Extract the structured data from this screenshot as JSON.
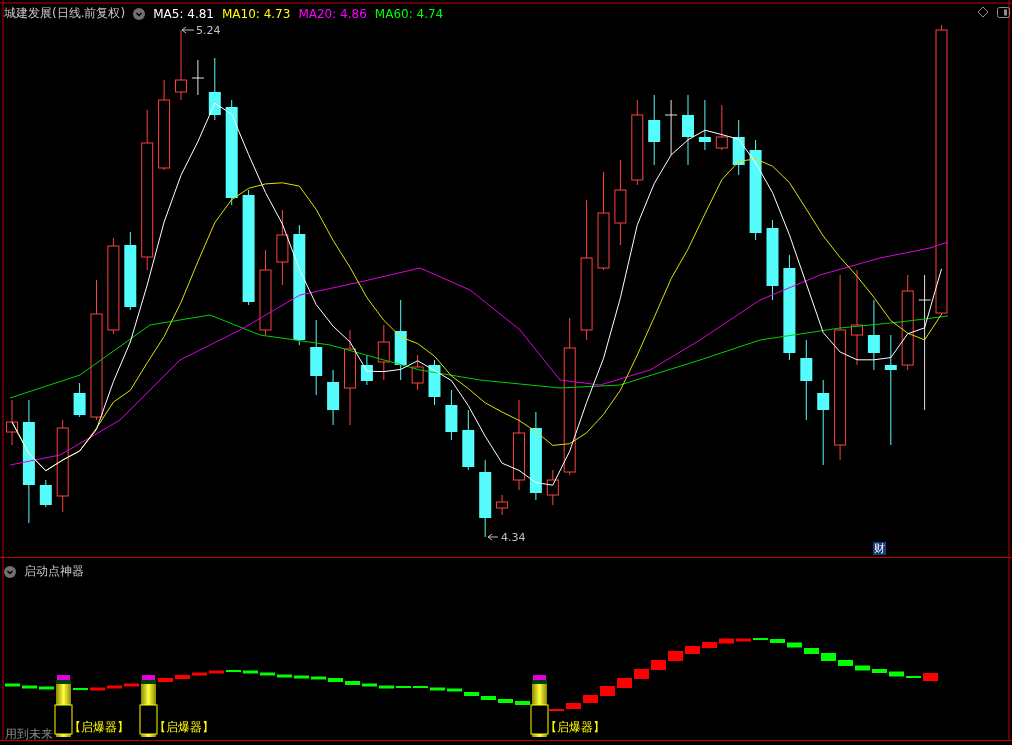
{
  "header": {
    "title": "城建发展(日线.前复权)",
    "averages": [
      {
        "label": "MA5: 4.81",
        "color": "#ffffff"
      },
      {
        "label": "MA10: 4.73",
        "color": "#ffff00"
      },
      {
        "label": "MA20: 4.86",
        "color": "#ff00ff"
      },
      {
        "label": "MA60: 4.74",
        "color": "#00ff00"
      }
    ]
  },
  "price_chart": {
    "high_label": "5.24",
    "low_label": "4.34",
    "badge": "财"
  },
  "indicator": {
    "title": "启动点神器",
    "signals": [
      {
        "label": "【启爆器】"
      },
      {
        "label": "【启爆器】"
      },
      {
        "label": "【启爆器】"
      }
    ],
    "note": "用到未来"
  }
}
